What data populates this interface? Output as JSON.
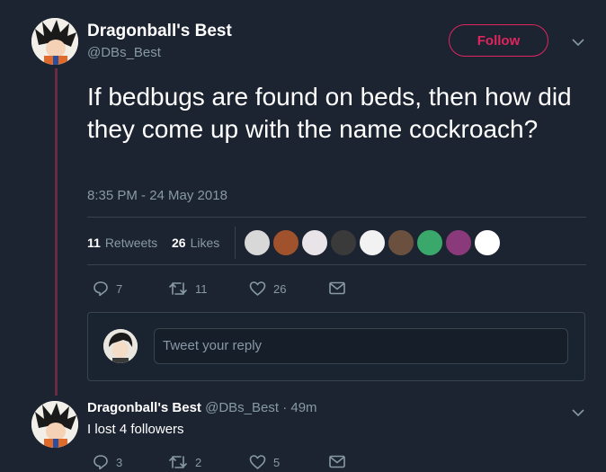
{
  "tweet": {
    "author_name": "Dragonball's Best",
    "author_handle": "@DBs_Best",
    "follow_label": "Follow",
    "text": "If bedbugs are found on beds, then how did they come up with the name cockroach?",
    "timestamp": "8:35 PM - 24 May 2018",
    "retweets_count": "11",
    "retweets_label": "Retweets",
    "likes_count": "26",
    "likes_label": "Likes",
    "actions": {
      "replies": "7",
      "retweets": "11",
      "likes": "26"
    }
  },
  "reply_box": {
    "placeholder": "Tweet your reply"
  },
  "reply": {
    "author_name": "Dragonball's Best",
    "meta": "@DBs_Best · 49m",
    "text": "I lost 4 followers",
    "actions": {
      "replies": "3",
      "retweets": "2",
      "likes": "5"
    }
  },
  "icons": [
    "chevron-down-icon",
    "reply-icon",
    "retweet-icon",
    "heart-icon",
    "envelope-icon"
  ],
  "colors": {
    "background": "#1c2431",
    "accent": "#e0245e",
    "muted": "#8899a6",
    "thread_line": "#6b2a43"
  }
}
